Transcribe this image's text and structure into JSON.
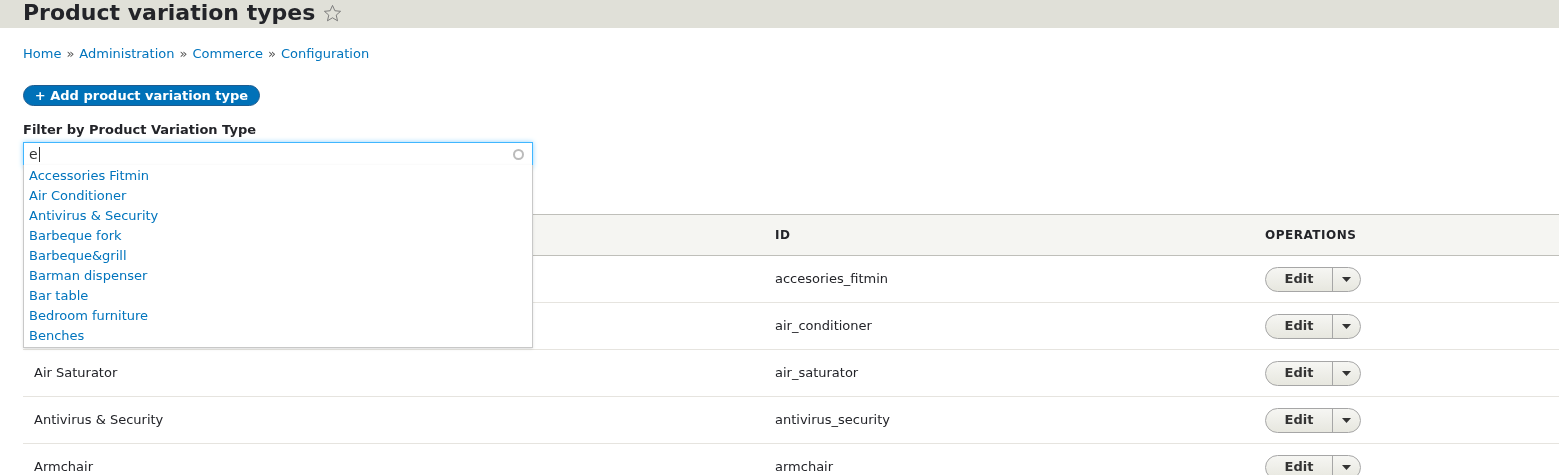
{
  "page": {
    "title": "Product variation types",
    "favorite": false
  },
  "breadcrumb": [
    "Home",
    "Administration",
    "Commerce",
    "Configuration"
  ],
  "breadcrumb_separator": "»",
  "add_button": "+ Add product variation type",
  "filter": {
    "label": "Filter by Product Variation Type",
    "value": "e",
    "suggestions": [
      "Accessories Fitmin",
      "Air Conditioner",
      "Antivirus & Security",
      "Barbeque fork",
      "Barbeque&grill",
      "Barman dispenser",
      "Bar table",
      "Bedroom furniture",
      "Benches"
    ]
  },
  "table": {
    "columns": [
      "ID",
      "OPERATIONS"
    ],
    "rows": [
      {
        "id": "accesories_fitmin",
        "operation": "Edit"
      },
      {
        "id": "air_conditioner",
        "operation": "Edit"
      },
      {
        "name": "Air Saturator",
        "id": "air_saturator",
        "operation": "Edit"
      },
      {
        "name": "Antivirus & Security",
        "id": "antivirus_security",
        "operation": "Edit"
      },
      {
        "name": "Armchair",
        "id": "armchair",
        "operation": "Edit"
      }
    ]
  }
}
